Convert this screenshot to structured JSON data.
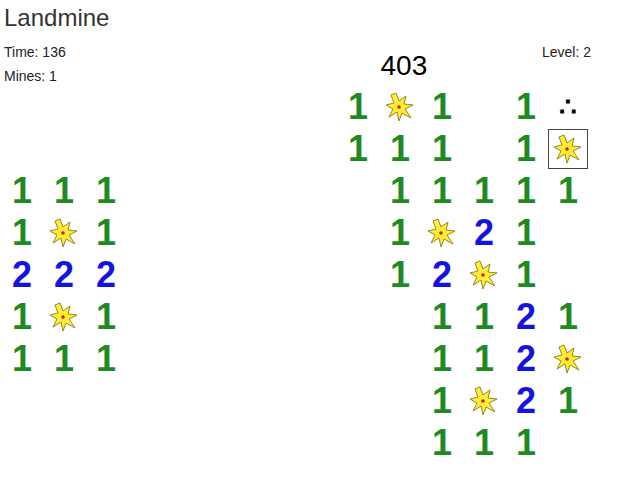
{
  "app": {
    "title": "Landmine"
  },
  "stats": {
    "time": "Time: 136",
    "mines": "Mines: 1",
    "score": "403",
    "level": "Level: 2"
  },
  "board": [
    [
      {
        "kind": "empty",
        "selected": false
      },
      {
        "kind": "empty",
        "selected": false
      },
      {
        "kind": "empty",
        "selected": false
      },
      {
        "kind": "empty",
        "selected": false
      },
      {
        "kind": "empty",
        "selected": false
      },
      {
        "kind": "empty",
        "selected": false
      },
      {
        "kind": "empty",
        "selected": false
      },
      {
        "kind": "empty",
        "selected": false
      },
      {
        "kind": "number",
        "text": "1",
        "color": "#1f8a1f",
        "selected": false
      },
      {
        "kind": "mine",
        "selected": false
      },
      {
        "kind": "number",
        "text": "1",
        "color": "#1f8a1f",
        "selected": false
      },
      {
        "kind": "empty",
        "selected": false
      },
      {
        "kind": "number",
        "text": "1",
        "color": "#1f8a1f",
        "selected": false
      },
      {
        "kind": "glyph",
        "text": "∴",
        "selected": false
      }
    ],
    [
      {
        "kind": "empty",
        "selected": false
      },
      {
        "kind": "empty",
        "selected": false
      },
      {
        "kind": "empty",
        "selected": false
      },
      {
        "kind": "empty",
        "selected": false
      },
      {
        "kind": "empty",
        "selected": false
      },
      {
        "kind": "empty",
        "selected": false
      },
      {
        "kind": "empty",
        "selected": false
      },
      {
        "kind": "empty",
        "selected": false
      },
      {
        "kind": "number",
        "text": "1",
        "color": "#1f8a1f",
        "selected": false
      },
      {
        "kind": "number",
        "text": "1",
        "color": "#1f8a1f",
        "selected": false
      },
      {
        "kind": "number",
        "text": "1",
        "color": "#1f8a1f",
        "selected": false
      },
      {
        "kind": "empty",
        "selected": false
      },
      {
        "kind": "number",
        "text": "1",
        "color": "#1f8a1f",
        "selected": false
      },
      {
        "kind": "mine",
        "selected": true
      }
    ],
    [
      {
        "kind": "number",
        "text": "1",
        "color": "#1f8a1f",
        "selected": false
      },
      {
        "kind": "number",
        "text": "1",
        "color": "#1f8a1f",
        "selected": false
      },
      {
        "kind": "number",
        "text": "1",
        "color": "#1f8a1f",
        "selected": false
      },
      {
        "kind": "empty",
        "selected": false
      },
      {
        "kind": "empty",
        "selected": false
      },
      {
        "kind": "empty",
        "selected": false
      },
      {
        "kind": "empty",
        "selected": false
      },
      {
        "kind": "empty",
        "selected": false
      },
      {
        "kind": "empty",
        "selected": false
      },
      {
        "kind": "number",
        "text": "1",
        "color": "#1f8a1f",
        "selected": false
      },
      {
        "kind": "number",
        "text": "1",
        "color": "#1f8a1f",
        "selected": false
      },
      {
        "kind": "number",
        "text": "1",
        "color": "#1f8a1f",
        "selected": false
      },
      {
        "kind": "number",
        "text": "1",
        "color": "#1f8a1f",
        "selected": false
      },
      {
        "kind": "number",
        "text": "1",
        "color": "#1f8a1f",
        "selected": false
      }
    ],
    [
      {
        "kind": "number",
        "text": "1",
        "color": "#1f8a1f",
        "selected": false
      },
      {
        "kind": "mine",
        "selected": false
      },
      {
        "kind": "number",
        "text": "1",
        "color": "#1f8a1f",
        "selected": false
      },
      {
        "kind": "empty",
        "selected": false
      },
      {
        "kind": "empty",
        "selected": false
      },
      {
        "kind": "empty",
        "selected": false
      },
      {
        "kind": "empty",
        "selected": false
      },
      {
        "kind": "empty",
        "selected": false
      },
      {
        "kind": "empty",
        "selected": false
      },
      {
        "kind": "number",
        "text": "1",
        "color": "#1f8a1f",
        "selected": false
      },
      {
        "kind": "mine",
        "selected": false
      },
      {
        "kind": "number",
        "text": "2",
        "color": "#1414e0",
        "selected": false
      },
      {
        "kind": "number",
        "text": "1",
        "color": "#1f8a1f",
        "selected": false
      },
      {
        "kind": "empty",
        "selected": false
      }
    ],
    [
      {
        "kind": "number",
        "text": "2",
        "color": "#1414e0",
        "selected": false
      },
      {
        "kind": "number",
        "text": "2",
        "color": "#1414e0",
        "selected": false
      },
      {
        "kind": "number",
        "text": "2",
        "color": "#1414e0",
        "selected": false
      },
      {
        "kind": "empty",
        "selected": false
      },
      {
        "kind": "empty",
        "selected": false
      },
      {
        "kind": "empty",
        "selected": false
      },
      {
        "kind": "empty",
        "selected": false
      },
      {
        "kind": "empty",
        "selected": false
      },
      {
        "kind": "empty",
        "selected": false
      },
      {
        "kind": "number",
        "text": "1",
        "color": "#1f8a1f",
        "selected": false
      },
      {
        "kind": "number",
        "text": "2",
        "color": "#1414e0",
        "selected": false
      },
      {
        "kind": "mine",
        "selected": false
      },
      {
        "kind": "number",
        "text": "1",
        "color": "#1f8a1f",
        "selected": false
      },
      {
        "kind": "empty",
        "selected": false
      }
    ],
    [
      {
        "kind": "number",
        "text": "1",
        "color": "#1f8a1f",
        "selected": false
      },
      {
        "kind": "mine",
        "selected": false
      },
      {
        "kind": "number",
        "text": "1",
        "color": "#1f8a1f",
        "selected": false
      },
      {
        "kind": "empty",
        "selected": false
      },
      {
        "kind": "empty",
        "selected": false
      },
      {
        "kind": "empty",
        "selected": false
      },
      {
        "kind": "empty",
        "selected": false
      },
      {
        "kind": "empty",
        "selected": false
      },
      {
        "kind": "empty",
        "selected": false
      },
      {
        "kind": "empty",
        "selected": false
      },
      {
        "kind": "number",
        "text": "1",
        "color": "#1f8a1f",
        "selected": false
      },
      {
        "kind": "number",
        "text": "1",
        "color": "#1f8a1f",
        "selected": false
      },
      {
        "kind": "number",
        "text": "2",
        "color": "#1414e0",
        "selected": false
      },
      {
        "kind": "number",
        "text": "1",
        "color": "#1f8a1f",
        "selected": false
      }
    ],
    [
      {
        "kind": "number",
        "text": "1",
        "color": "#1f8a1f",
        "selected": false
      },
      {
        "kind": "number",
        "text": "1",
        "color": "#1f8a1f",
        "selected": false
      },
      {
        "kind": "number",
        "text": "1",
        "color": "#1f8a1f",
        "selected": false
      },
      {
        "kind": "empty",
        "selected": false
      },
      {
        "kind": "empty",
        "selected": false
      },
      {
        "kind": "empty",
        "selected": false
      },
      {
        "kind": "empty",
        "selected": false
      },
      {
        "kind": "empty",
        "selected": false
      },
      {
        "kind": "empty",
        "selected": false
      },
      {
        "kind": "empty",
        "selected": false
      },
      {
        "kind": "number",
        "text": "1",
        "color": "#1f8a1f",
        "selected": false
      },
      {
        "kind": "number",
        "text": "1",
        "color": "#1f8a1f",
        "selected": false
      },
      {
        "kind": "number",
        "text": "2",
        "color": "#1414e0",
        "selected": false
      },
      {
        "kind": "mine",
        "selected": false
      }
    ],
    [
      {
        "kind": "empty",
        "selected": false
      },
      {
        "kind": "empty",
        "selected": false
      },
      {
        "kind": "empty",
        "selected": false
      },
      {
        "kind": "empty",
        "selected": false
      },
      {
        "kind": "empty",
        "selected": false
      },
      {
        "kind": "empty",
        "selected": false
      },
      {
        "kind": "empty",
        "selected": false
      },
      {
        "kind": "empty",
        "selected": false
      },
      {
        "kind": "empty",
        "selected": false
      },
      {
        "kind": "empty",
        "selected": false
      },
      {
        "kind": "number",
        "text": "1",
        "color": "#1f8a1f",
        "selected": false
      },
      {
        "kind": "mine",
        "selected": false
      },
      {
        "kind": "number",
        "text": "2",
        "color": "#1414e0",
        "selected": false
      },
      {
        "kind": "number",
        "text": "1",
        "color": "#1f8a1f",
        "selected": false
      }
    ],
    [
      {
        "kind": "empty",
        "selected": false
      },
      {
        "kind": "empty",
        "selected": false
      },
      {
        "kind": "empty",
        "selected": false
      },
      {
        "kind": "empty",
        "selected": false
      },
      {
        "kind": "empty",
        "selected": false
      },
      {
        "kind": "empty",
        "selected": false
      },
      {
        "kind": "empty",
        "selected": false
      },
      {
        "kind": "empty",
        "selected": false
      },
      {
        "kind": "empty",
        "selected": false
      },
      {
        "kind": "empty",
        "selected": false
      },
      {
        "kind": "number",
        "text": "1",
        "color": "#1f8a1f",
        "selected": false
      },
      {
        "kind": "number",
        "text": "1",
        "color": "#1f8a1f",
        "selected": false
      },
      {
        "kind": "number",
        "text": "1",
        "color": "#1f8a1f",
        "selected": false
      },
      {
        "kind": "empty",
        "selected": false
      }
    ]
  ]
}
